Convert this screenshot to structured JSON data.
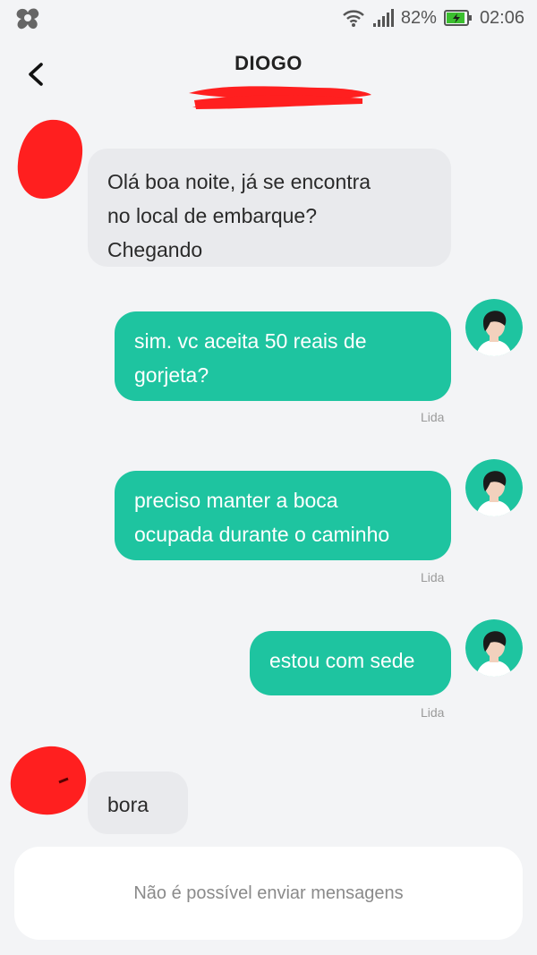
{
  "status_bar": {
    "battery": "82%",
    "time": "02:06"
  },
  "header": {
    "title": "DIOGO"
  },
  "messages": [
    {
      "direction": "in",
      "text": "Olá boa noite, já se encontra\nno local de embarque?\nChegando"
    },
    {
      "direction": "out",
      "text": "sim. vc aceita 50 reais de\ngorjeta?",
      "status": "Lida"
    },
    {
      "direction": "out",
      "text": "preciso manter a boca\nocupada durante o caminho",
      "status": "Lida"
    },
    {
      "direction": "out",
      "text": "estou com sede",
      "status": "Lida"
    },
    {
      "direction": "in",
      "text": "bora"
    }
  ],
  "footer": {
    "notice": "Não é possível enviar mensagens"
  },
  "colors": {
    "outgoing_bubble": "#1ec4a0",
    "incoming_bubble": "#e9eaed",
    "background": "#f3f4f6",
    "redaction": "#ff1f1f"
  },
  "icons": {
    "status_left": "app-notification-icon",
    "wifi": "wifi-icon",
    "signal": "signal-icon",
    "battery": "battery-charging-icon",
    "back": "back-chevron-icon",
    "avatar": "driver-avatar-icon"
  }
}
